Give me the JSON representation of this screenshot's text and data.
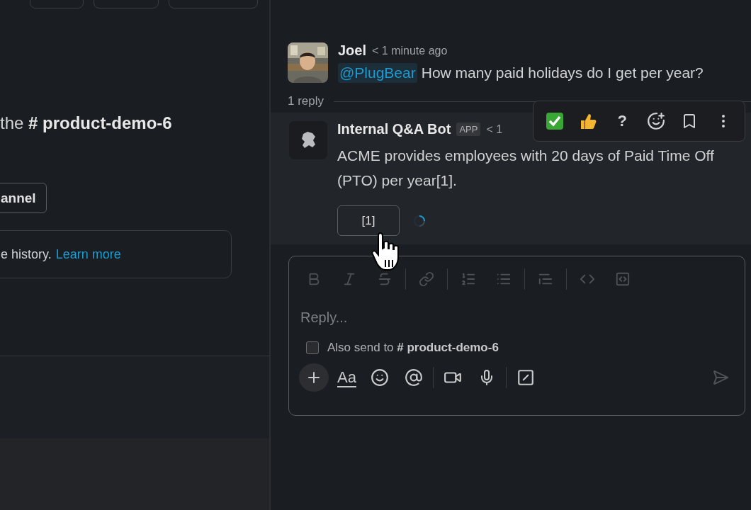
{
  "left_panel": {
    "heading": "the **# product-demo-6**",
    "button": "annel",
    "notice": {
      "text": "e history.",
      "link": "Learn more"
    }
  },
  "thread": {
    "parent": {
      "author": "Joel",
      "time": "< 1 minute ago",
      "mention": "@PlugBear",
      "text": "How many paid holidays do I get per year?"
    },
    "reply_count": "1 reply",
    "reply": {
      "author": "Internal Q&A Bot",
      "badge": "APP",
      "time": "< 1",
      "text": "ACME provides employees with 20 days of Paid Time Off (PTO) per year[1].",
      "citation_button": "[1]",
      "loading": true
    },
    "hover_actions": [
      {
        "kind": "check"
      },
      {
        "kind": "thumbs"
      },
      {
        "kind": "text",
        "label": "?"
      },
      {
        "kind": "react"
      },
      {
        "kind": "bookmark"
      },
      {
        "kind": "more"
      }
    ]
  },
  "composer": {
    "format_buttons": [
      {
        "kind": "bold",
        "disabled": true
      },
      {
        "kind": "italic",
        "disabled": true
      },
      {
        "kind": "strike",
        "disabled": true
      },
      {
        "kind": "sep"
      },
      {
        "kind": "link",
        "disabled": true
      },
      {
        "kind": "sep"
      },
      {
        "kind": "ordered",
        "disabled": true
      },
      {
        "kind": "bullet",
        "disabled": true
      },
      {
        "kind": "sep"
      },
      {
        "kind": "quote",
        "disabled": true
      },
      {
        "kind": "sep"
      },
      {
        "kind": "code",
        "disabled": true
      },
      {
        "kind": "codeblock",
        "disabled": true
      }
    ],
    "placeholder": "Reply...",
    "also_send": {
      "label": "Also send to **# product-demo-6**",
      "checked": false
    },
    "format_toggle": "Aa",
    "send_disabled": true
  }
}
